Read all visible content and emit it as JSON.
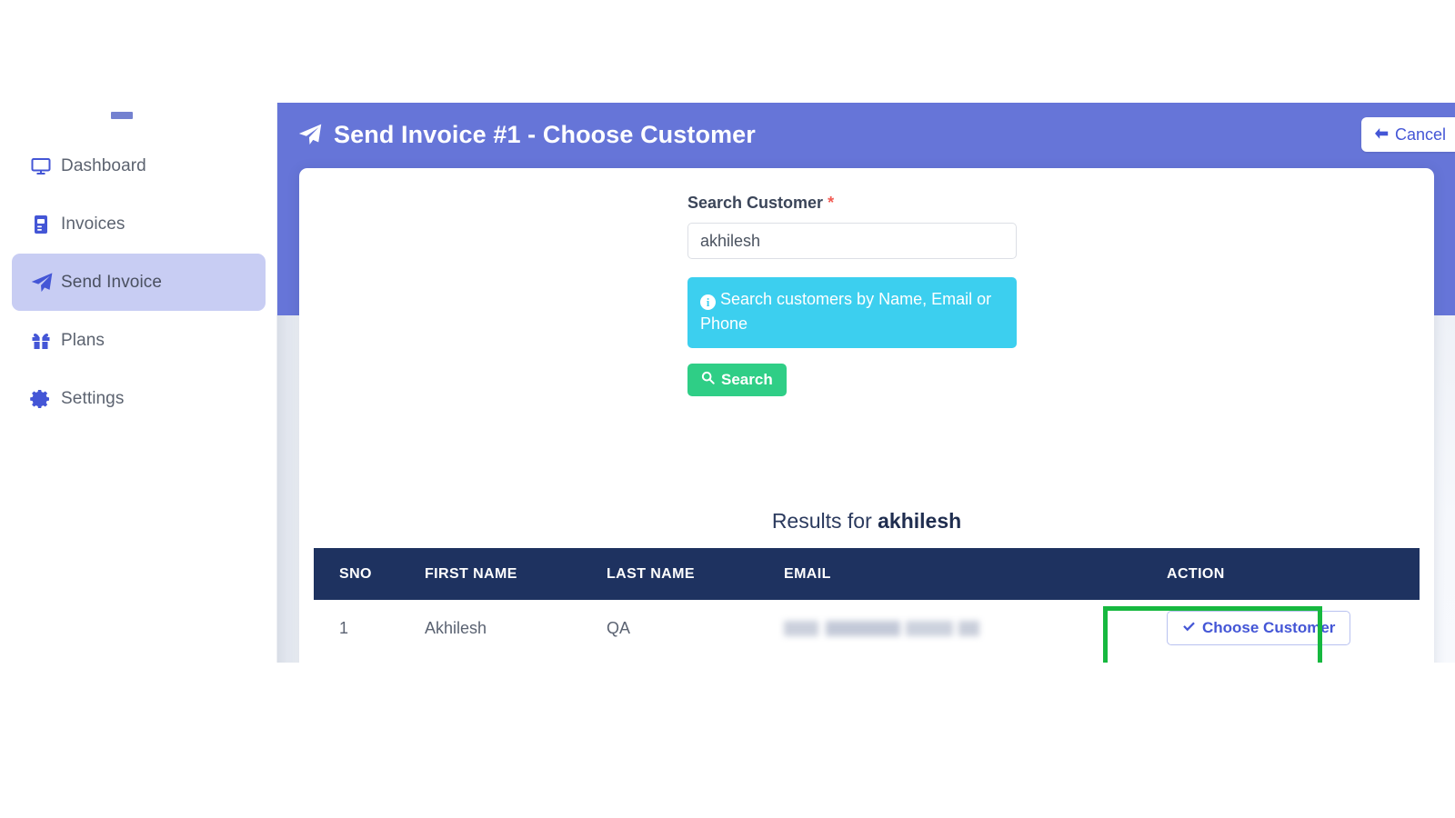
{
  "sidebar": {
    "items": [
      {
        "label": "Dashboard",
        "icon": "monitor-icon",
        "active": false
      },
      {
        "label": "Invoices",
        "icon": "invoice-document-icon",
        "active": false
      },
      {
        "label": "Send Invoice",
        "icon": "paper-plane-icon",
        "active": true
      },
      {
        "label": "Plans",
        "icon": "gift-icon",
        "active": false
      },
      {
        "label": "Settings",
        "icon": "gear-icon",
        "active": false
      }
    ]
  },
  "modal": {
    "title": "Send Invoice #1 - Choose Customer",
    "title_icon": "paper-plane-icon",
    "cancel_label": "Cancel",
    "cancel_icon": "arrow-left-icon"
  },
  "form": {
    "label": "Search Customer",
    "required_marker": "*",
    "value": "akhilesh",
    "placeholder": "Search Customer",
    "info_text": "Search customers by Name, Email or Phone",
    "info_icon": "info-circle-icon",
    "search_button": "Search",
    "search_button_icon": "magnifier-icon"
  },
  "results": {
    "heading_prefix": "Results for ",
    "heading_term": "akhilesh",
    "columns": [
      "SNO",
      "FIRST NAME",
      "LAST NAME",
      "EMAIL",
      "ACTION"
    ],
    "rows": [
      {
        "sno": "1",
        "first_name": "Akhilesh",
        "last_name": "QA",
        "email": "",
        "action_label": "Choose Customer",
        "action_icon": "check-icon"
      }
    ]
  },
  "colors": {
    "brand_purple": "#6675d8",
    "accent_blue": "#4456d6",
    "info_cyan": "#3ccfef",
    "success_green": "#2fce86",
    "table_header_navy": "#1e3260",
    "highlight_green": "#16b83f",
    "active_nav_bg": "#c8cdf3"
  }
}
